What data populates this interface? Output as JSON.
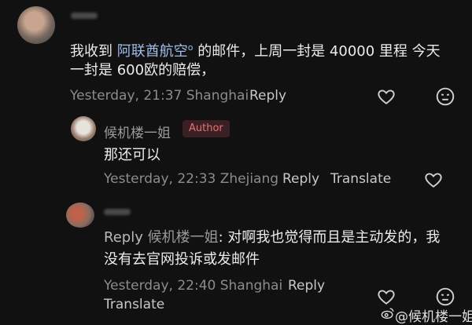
{
  "comment1": {
    "text_prefix": "我收到",
    "mention": "阿联酋航空",
    "mention_suffix": "o",
    "text_rest": "的邮件，上周一封是 40000 里程 今天",
    "text_line2": "一封是 600欧的赔偿，",
    "meta": "Yesterday, 21:37 Shanghai",
    "reply_label": "Reply"
  },
  "comment2": {
    "author": "候机楼一姐",
    "badge": "Author",
    "text": "那还可以",
    "meta": "Yesterday, 22:33 Zhejiang",
    "reply_label": "Reply",
    "translate_label": "Translate"
  },
  "comment3": {
    "reply_prefix": "Reply",
    "reply_to": "候机楼一姐",
    "text_line1_rest": ": 对啊我也觉得而且是主动发的，我",
    "text_line2": "没有去官网投诉或发邮件",
    "meta": "Yesterday, 22:40 Shanghai",
    "reply_label": "Reply",
    "translate_label": "Translate"
  },
  "watermark": "@候机楼一姐",
  "icons": [
    "heart-icon",
    "dislike-face-icon"
  ]
}
